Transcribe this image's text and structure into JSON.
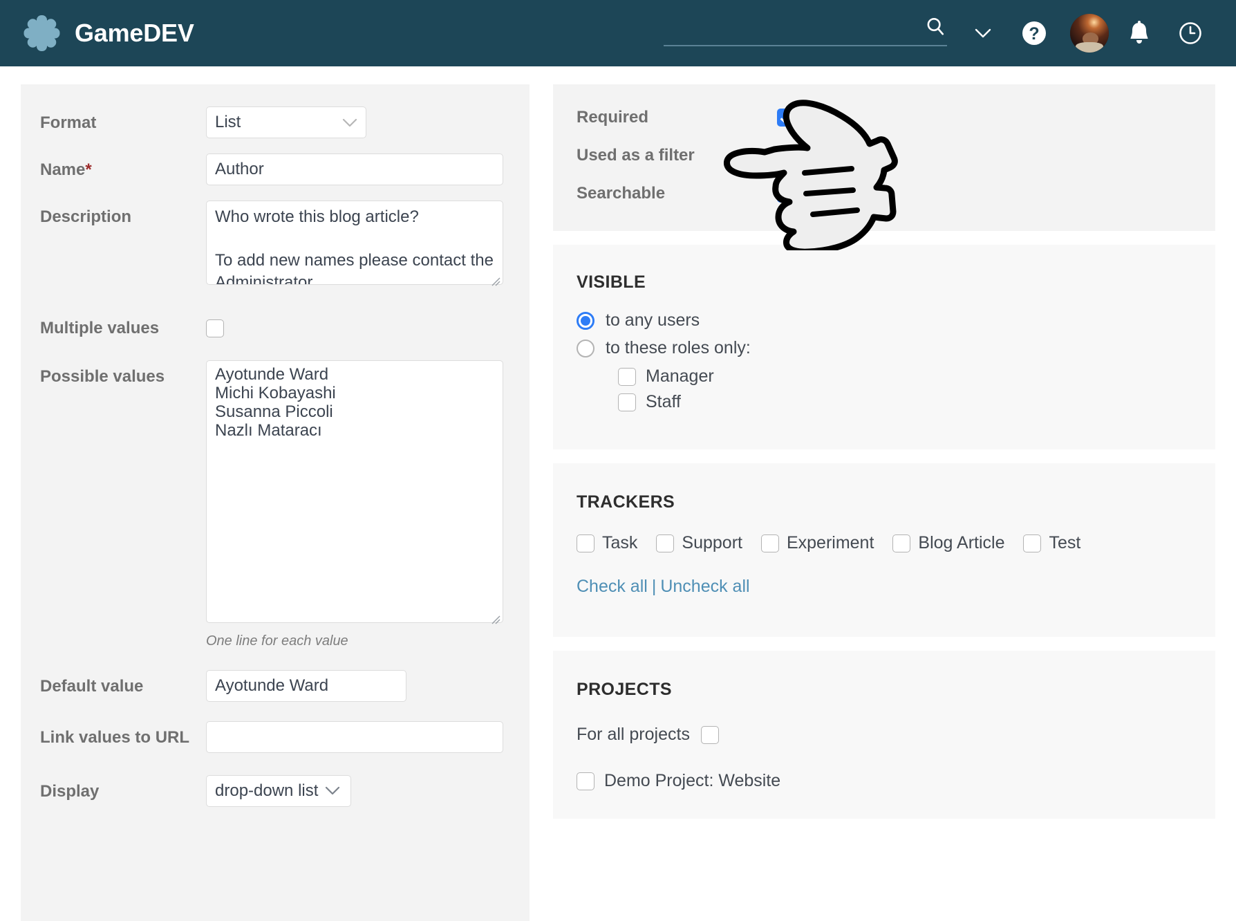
{
  "header": {
    "brand": "GameDEV",
    "logo_icon": "asterisk-logo-icon",
    "search_value": "",
    "search_placeholder": "",
    "icons": [
      "search-icon",
      "chevron-down-icon",
      "help-icon",
      "avatar",
      "notifications-bell-icon",
      "recent-clock-icon"
    ]
  },
  "left_panel": {
    "format": {
      "label": "Format",
      "value": "List"
    },
    "name": {
      "label": "Name",
      "required_marker": "*",
      "value": "Author"
    },
    "description": {
      "label": "Description",
      "value": "Who wrote this blog article?\n\nTo add new names please contact the Administrator."
    },
    "multiple_values": {
      "label": "Multiple values",
      "checked": false
    },
    "possible_values": {
      "label": "Possible values",
      "value": "Ayotunde Ward\nMichi Kobayashi\nSusanna Piccoli\nNazlı Mataracı",
      "items": [
        "Ayotunde Ward",
        "Michi Kobayashi",
        "Susanna Piccoli",
        "Nazlı Mataracı"
      ],
      "hint": "One line for each value"
    },
    "default_value": {
      "label": "Default value",
      "value": "Ayotunde Ward"
    },
    "link_values_to_url": {
      "label": "Link values to URL",
      "value": ""
    },
    "display": {
      "label": "Display",
      "value": "drop-down list"
    }
  },
  "flags": {
    "items": [
      {
        "label": "Required",
        "checked": true
      },
      {
        "label": "Used as a filter",
        "checked": true
      },
      {
        "label": "Searchable",
        "checked": true
      }
    ]
  },
  "visible": {
    "title": "VISIBLE",
    "options": [
      {
        "label": "to any users",
        "selected": true
      },
      {
        "label": "to these roles only:",
        "selected": false
      }
    ],
    "roles": [
      {
        "label": "Manager",
        "checked": false
      },
      {
        "label": "Staff",
        "checked": false
      }
    ]
  },
  "trackers": {
    "title": "TRACKERS",
    "items": [
      {
        "label": "Task",
        "checked": false
      },
      {
        "label": "Support",
        "checked": false
      },
      {
        "label": "Experiment",
        "checked": false
      },
      {
        "label": "Blog Article",
        "checked": false
      },
      {
        "label": "Test",
        "checked": false
      }
    ],
    "check_all": "Check all",
    "separator": "|",
    "uncheck_all": "Uncheck all"
  },
  "projects": {
    "title": "PROJECTS",
    "for_all_label": "For all projects",
    "for_all_checked": false,
    "items": [
      {
        "label": "Demo Project: Website",
        "checked": false
      }
    ]
  },
  "overlay": {
    "cursor_icon": "pointing-hand-cursor-icon"
  },
  "colors": {
    "header_bg": "#1d4657",
    "logo": "#7fafc4",
    "accent_checked": "#2d7cf6",
    "link": "#4f8fb5",
    "panel_bg": "#f3f3f3",
    "card_bg": "#f8f8f8",
    "required_star": "#9c2b2b"
  }
}
